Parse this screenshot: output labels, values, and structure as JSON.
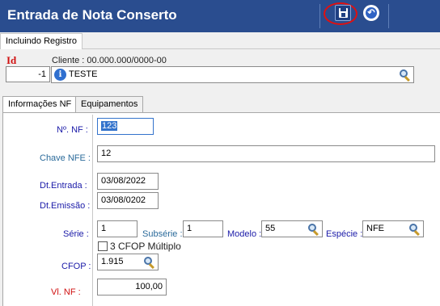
{
  "window": {
    "title": "Entrada de Nota Conserto"
  },
  "toolbar": {
    "save_icon": "floppy-disk-icon",
    "back_icon": "undo-arrow-icon",
    "accent": "#2a4d8f"
  },
  "status": {
    "mode_label": "Incluindo Registro"
  },
  "header": {
    "id_label": "Id",
    "id_value": "-1",
    "cliente_label": "Cliente : 00.000.000/0000-00",
    "cliente_value": "TESTE"
  },
  "tabs": [
    {
      "label": "Informações NF",
      "active": true
    },
    {
      "label": "Equipamentos",
      "active": false
    }
  ],
  "form": {
    "numero_nf": {
      "label": "Nº. NF :",
      "value": "123"
    },
    "chave_nfe": {
      "label": "Chave NFE :",
      "value": "12"
    },
    "dt_entrada": {
      "label": "Dt.Entrada :",
      "value": "03/08/2022"
    },
    "dt_emissao": {
      "label": "Dt.Emissão :",
      "value": "03/08/0202"
    },
    "serie": {
      "label": "Série :",
      "value": "1"
    },
    "subserie": {
      "label": "Subsérie :",
      "value": "1"
    },
    "modelo": {
      "label": "Modelo :",
      "value": "55"
    },
    "especie": {
      "label": "Espécie :",
      "value": "NFE"
    },
    "cfop_multiplo": {
      "label": "3 CFOP Múltiplo",
      "checked": false
    },
    "cfop": {
      "label": "CFOP :",
      "value": "1.915"
    },
    "vl_nf": {
      "label": "Vl. NF :",
      "value": "100,00"
    }
  }
}
